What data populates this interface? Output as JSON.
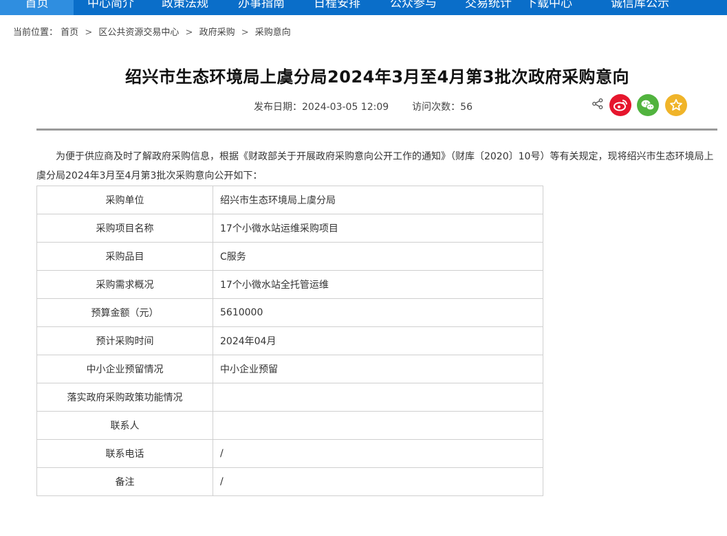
{
  "nav": {
    "items": [
      "首页",
      "中心简介",
      "政策法规",
      "办事指南",
      "日程安排",
      "公众参与",
      "交易统计",
      "下载中心",
      "诚信库公示"
    ]
  },
  "breadcrumb": {
    "prefix": "当前位置：",
    "items": [
      "首页",
      "区公共资源交易中心",
      "政府采购",
      "采购意向"
    ],
    "separator": ">"
  },
  "article": {
    "title": "绍兴市生态环境局上虞分局2024年3月至4月第3批次政府采购意向",
    "publish_label": "发布日期：",
    "publish_date": "2024-03-05 12:09",
    "visits_label": "访问次数：",
    "visits": "56",
    "intro": "为便于供应商及时了解政府采购信息，根据《财政部关于开展政府采购意向公开工作的通知》（财库〔2020〕10号）等有关规定，现将绍兴市生态环境局上虞分局2024年3月至4月第3批次采购意向公开如下：",
    "rows": [
      {
        "label": "采购单位",
        "value": "绍兴市生态环境局上虞分局"
      },
      {
        "label": "采购项目名称",
        "value": "17个小微水站运维采购项目"
      },
      {
        "label": "采购品目",
        "value": "C服务"
      },
      {
        "label": "采购需求概况",
        "value": "17个小微水站全托管运维"
      },
      {
        "label": "预算金额（元）",
        "value": "5610000"
      },
      {
        "label": "预计采购时间",
        "value": "2024年04月"
      },
      {
        "label": "中小企业预留情况",
        "value": "中小企业预留"
      },
      {
        "label": "落实政府采购政策功能情况",
        "value": ""
      },
      {
        "label": "联系人",
        "value": ""
      },
      {
        "label": "联系电话",
        "value": "/"
      },
      {
        "label": "备注",
        "value": "/"
      }
    ]
  },
  "share": {
    "icons": [
      "share-icon",
      "weibo-icon",
      "wechat-icon",
      "favorite-icon"
    ],
    "colors": {
      "weibo": "#e6162d",
      "wechat": "#51b33e",
      "favorite": "#f0b429"
    }
  },
  "colors": {
    "nav_bg": "#0a6ec9",
    "nav_active": "#2f8ee0"
  }
}
